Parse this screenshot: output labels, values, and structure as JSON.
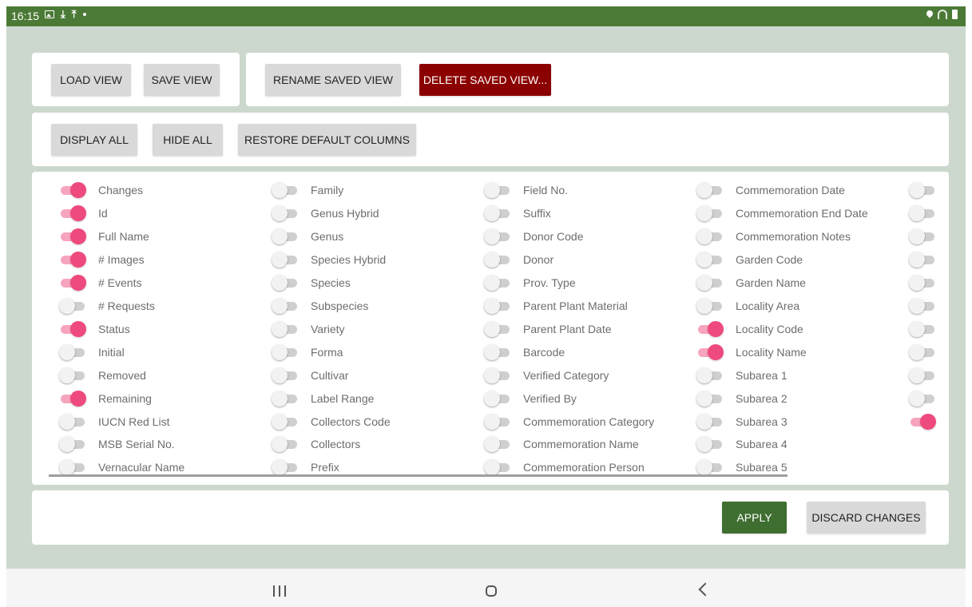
{
  "status_bar": {
    "time": "16:15"
  },
  "view_bar": {
    "load_label": "LOAD VIEW",
    "save_label": "SAVE VIEW",
    "rename_label": "RENAME SAVED VIEW",
    "delete_label": "DELETE SAVED VIEW..."
  },
  "display_bar": {
    "display_all_label": "DISPLAY ALL",
    "hide_all_label": "HIDE ALL",
    "restore_label": "RESTORE DEFAULT COLUMNS"
  },
  "columns": [
    [
      {
        "label": "Changes",
        "on": true
      },
      {
        "label": "Id",
        "on": true
      },
      {
        "label": "Full Name",
        "on": true
      },
      {
        "label": "# Images",
        "on": true
      },
      {
        "label": "# Events",
        "on": true
      },
      {
        "label": "# Requests",
        "on": false
      },
      {
        "label": "Status",
        "on": true
      },
      {
        "label": "Initial",
        "on": false
      },
      {
        "label": "Removed",
        "on": false
      },
      {
        "label": "Remaining",
        "on": true
      },
      {
        "label": "IUCN Red List",
        "on": false
      },
      {
        "label": "MSB Serial No.",
        "on": false
      },
      {
        "label": "Vernacular Name",
        "on": false
      }
    ],
    [
      {
        "label": "Family",
        "on": false
      },
      {
        "label": "Genus Hybrid",
        "on": false
      },
      {
        "label": "Genus",
        "on": false
      },
      {
        "label": "Species Hybrid",
        "on": false
      },
      {
        "label": "Species",
        "on": false
      },
      {
        "label": "Subspecies",
        "on": false
      },
      {
        "label": "Variety",
        "on": false
      },
      {
        "label": "Forma",
        "on": false
      },
      {
        "label": "Cultivar",
        "on": false
      },
      {
        "label": "Label Range",
        "on": false
      },
      {
        "label": "Collectors Code",
        "on": false
      },
      {
        "label": "Collectors",
        "on": false
      },
      {
        "label": "Prefix",
        "on": false
      }
    ],
    [
      {
        "label": "Field No.",
        "on": false
      },
      {
        "label": "Suffix",
        "on": false
      },
      {
        "label": "Donor Code",
        "on": false
      },
      {
        "label": "Donor",
        "on": false
      },
      {
        "label": "Prov. Type",
        "on": false
      },
      {
        "label": "Parent Plant Material",
        "on": false
      },
      {
        "label": "Parent Plant Date",
        "on": false
      },
      {
        "label": "Barcode",
        "on": false
      },
      {
        "label": "Verified Category",
        "on": false
      },
      {
        "label": "Verified By",
        "on": false
      },
      {
        "label": "Commemoration Category",
        "on": false
      },
      {
        "label": "Commemoration Name",
        "on": false
      },
      {
        "label": "Commemoration Person",
        "on": false
      }
    ],
    [
      {
        "label": "Commemoration Date",
        "on": false
      },
      {
        "label": "Commemoration End Date",
        "on": false
      },
      {
        "label": "Commemoration Notes",
        "on": false
      },
      {
        "label": "Garden Code",
        "on": false
      },
      {
        "label": "Garden Name",
        "on": false
      },
      {
        "label": "Locality Area",
        "on": false
      },
      {
        "label": "Locality Code",
        "on": true
      },
      {
        "label": "Locality Name",
        "on": true
      },
      {
        "label": "Subarea 1",
        "on": false
      },
      {
        "label": "Subarea 2",
        "on": false
      },
      {
        "label": "Subarea 3",
        "on": false
      },
      {
        "label": "Subarea 4",
        "on": false
      },
      {
        "label": "Subarea 5",
        "on": false
      }
    ],
    [
      {
        "label": "",
        "on": false
      },
      {
        "label": "",
        "on": false
      },
      {
        "label": "",
        "on": false
      },
      {
        "label": "",
        "on": false
      },
      {
        "label": "",
        "on": false
      },
      {
        "label": "",
        "on": false
      },
      {
        "label": "",
        "on": false
      },
      {
        "label": "",
        "on": false
      },
      {
        "label": "",
        "on": false
      },
      {
        "label": "",
        "on": false
      },
      {
        "label": "",
        "on": true
      }
    ]
  ],
  "footer": {
    "apply_label": "APPLY",
    "discard_label": "DISCARD CHANGES"
  },
  "colors": {
    "status_bar": "#4b7a36",
    "background": "#ccd8cd",
    "toggle_on": "#ee4a7d",
    "delete_button": "#8b0000",
    "apply_button": "#3f6e31"
  }
}
